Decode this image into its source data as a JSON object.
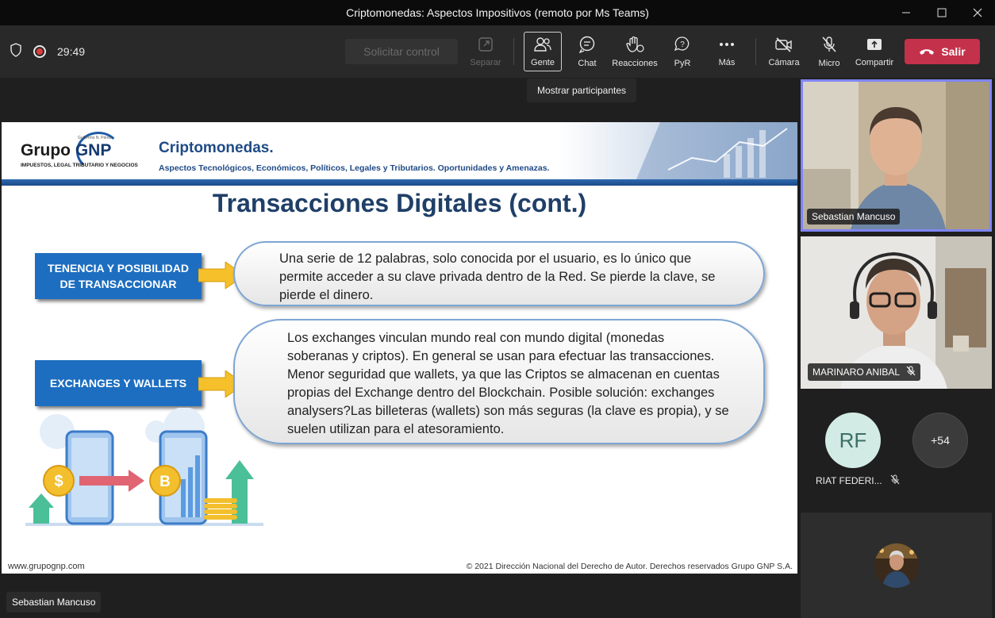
{
  "window": {
    "title": "Criptomonedas: Aspectos Impositivos (remoto por Ms Teams)"
  },
  "toolbar": {
    "timer": "29:49",
    "request_control": "Solicitar control",
    "buttons": {
      "separar": "Separar",
      "gente": "Gente",
      "chat": "Chat",
      "reacciones": "Reacciones",
      "pyr": "PyR",
      "mas": "Más",
      "camara": "Cámara",
      "micro": "Micro",
      "compartir": "Compartir"
    },
    "leave": "Salir",
    "leave_color": "#c4314b"
  },
  "tooltip": "Mostrar participantes",
  "slide": {
    "logo_main": "Grupo",
    "logo_brand": "GNP",
    "logo_small": "Guillermo N. Pérez",
    "logo_sub": "IMPUESTOS, LEGAL TRIBUTARIO Y NEGOCIOS",
    "header_title": "Criptomonedas.",
    "header_subtitle": "Aspectos Tecnológicos, Económicos, Políticos, Legales y Tributarios. Oportunidades y Amenazas.",
    "title": "Transacciones Digitales (cont.)",
    "items": [
      {
        "label_line1": "TENENCIA Y POSIBILIDAD",
        "label_line2": "DE TRANSACCIONAR",
        "text_lines": [
          "Una serie de 12 palabras, solo conocida por el usuario, es lo único que",
          "permite acceder a su clave privada dentro de la Red. Se pierde la clave, se",
          "pierde el dinero."
        ]
      },
      {
        "label_line1": "EXCHANGES Y WALLETS",
        "text_lines": [
          "Los exchanges vinculan mundo real con mundo digital (monedas",
          "soberanas y criptos). En general se usan para efectuar las transacciones.",
          "Menor seguridad que wallets, ya que las Criptos se almacenan en cuentas",
          "propias del Exchange dentro del Blockchain. Posible solución: exchanges",
          "analysers?Las billeteras (wallets) son más seguras (la clave es propia), y se",
          "suelen utilizan para el atesoramiento."
        ]
      }
    ],
    "footer_left": "www.grupognp.com",
    "footer_right": "© 2021 Dirección Nacional del Derecho de Autor. Derechos reservados Grupo GNP S.A."
  },
  "participants": {
    "tile1_name": "Sebastian Mancuso",
    "tile2_name": "MARINARO ANIBAL",
    "rf_initials": "RF",
    "rf_name": "RIAT FEDERI...",
    "more_count": "+54"
  },
  "presenter_name": "Sebastian Mancuso",
  "colors": {
    "accent_purple": "#7f85f5",
    "slide_blue": "#1d6ec0",
    "arrow_yellow": "#f6c02a",
    "rf_avatar_bg": "#d3ebe5",
    "rf_avatar_fg": "#3c7063"
  }
}
